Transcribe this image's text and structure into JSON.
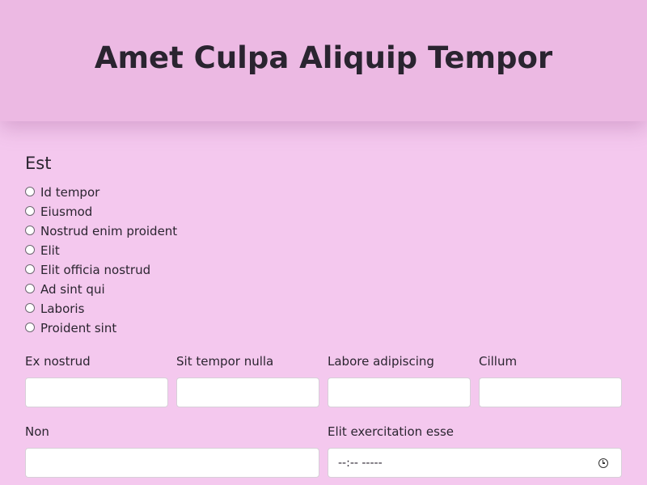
{
  "header": {
    "title": "Amet Culpa Aliquip Tempor"
  },
  "section": {
    "title": "Est",
    "radio_options": [
      {
        "label": "Id tempor"
      },
      {
        "label": "Eiusmod"
      },
      {
        "label": "Nostrud enim proident"
      },
      {
        "label": "Elit"
      },
      {
        "label": "Elit officia nostrud"
      },
      {
        "label": "Ad sint qui"
      },
      {
        "label": "Laboris"
      },
      {
        "label": "Proident sint"
      }
    ]
  },
  "fields_row1": [
    {
      "label": "Ex nostrud",
      "value": ""
    },
    {
      "label": "Sit tempor nulla",
      "value": ""
    },
    {
      "label": "Labore adipiscing",
      "value": ""
    },
    {
      "label": "Cillum",
      "value": ""
    }
  ],
  "fields_row2": {
    "text_field": {
      "label": "Non",
      "value": ""
    },
    "time_field": {
      "label": "Elit exercitation esse",
      "placeholder": "--:-- -----",
      "icon": "clock-icon"
    }
  },
  "colors": {
    "page_background": "#f4c8ee",
    "header_background": "#ecb9e3",
    "text": "#2b2530"
  }
}
